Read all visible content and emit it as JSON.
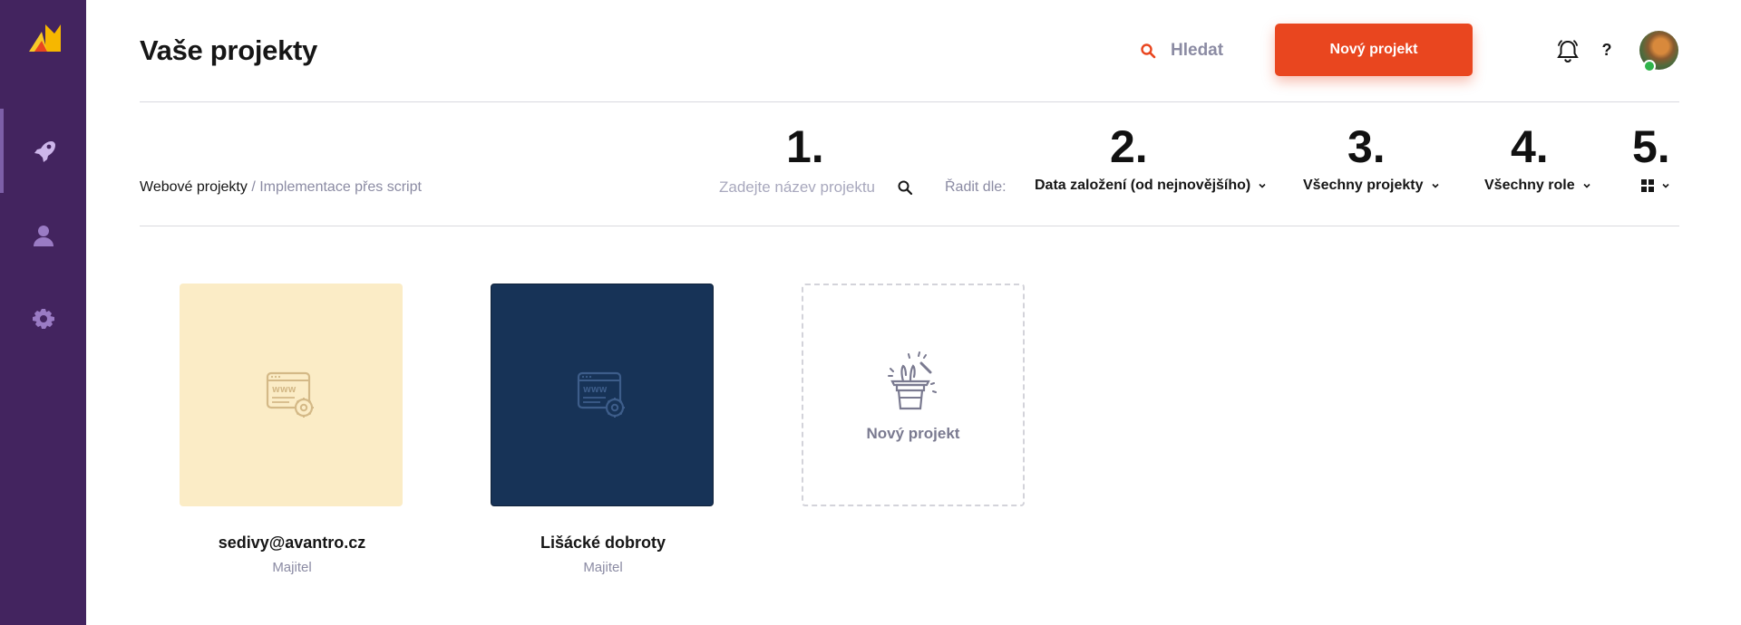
{
  "header": {
    "title": "Vaše projekty",
    "search_label": "Hledat",
    "new_project_label": "Nový projekt",
    "help_label": "?"
  },
  "breadcrumb": {
    "link": "Webové projekty",
    "separator": " / ",
    "current": "Implementace přes script"
  },
  "annotations": [
    "1.",
    "2.",
    "3.",
    "4.",
    "5."
  ],
  "filters": {
    "search_placeholder": "Zadejte název projektu",
    "sort_label": "Řadit dle:",
    "sort_value": "Data založení (od nejnovějšího)",
    "projects_filter": "Všechny projekty",
    "roles_filter": "Všechny role"
  },
  "projects": [
    {
      "name": "sedivy@avantro.cz",
      "role": "Majitel",
      "thumb_color": "#fbecc6",
      "icon": "website-settings-icon"
    },
    {
      "name": "Lišácké dobroty",
      "role": "Majitel",
      "thumb_color": "#173357",
      "icon": "website-settings-icon"
    }
  ],
  "new_project_card": {
    "label": "Nový projekt",
    "icon": "magic-hat-icon"
  },
  "colors": {
    "sidebar": "#43245f",
    "accent": "#e9461f",
    "muted_text": "#8b8ba3",
    "online": "#2fb34a"
  },
  "sidebar": {
    "items": [
      {
        "icon": "rocket-icon",
        "active": true
      },
      {
        "icon": "user-icon",
        "active": false
      },
      {
        "icon": "gear-icon",
        "active": false
      }
    ]
  }
}
